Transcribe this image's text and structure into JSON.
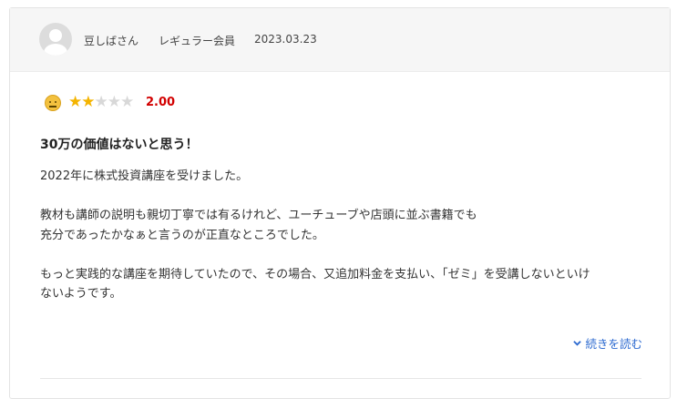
{
  "review": {
    "reviewer": {
      "name": "豆しばさん",
      "rank": "レギュラー会員",
      "date": "2023.03.23",
      "avatar_icon": "user-avatar-icon"
    },
    "rating": {
      "emoji_icon": "neutral-face-icon",
      "stars_filled": 2,
      "stars_total": 5,
      "score": "2.00",
      "star_color": "#f4b400",
      "score_color": "#d20000"
    },
    "title": "30万の価値はないと思う！",
    "body": {
      "line1": "2022年に株式投資講座を受けました。",
      "line2": "教材も講師の説明も親切丁寧では有るけれど、ユーチューブや店頭に並ぶ書籍でも",
      "line3": "充分であったかなぁと言うのが正直なところでした。",
      "line4": "もっと実践的な講座を期待していたので、その場合、又追加料金を支払い、「ゼミ」を受講しないといけ",
      "line5": "ないようです。"
    },
    "read_more": {
      "label": "続きを読む",
      "icon": "chevron-down-icon",
      "color": "#2d6ad0"
    }
  }
}
